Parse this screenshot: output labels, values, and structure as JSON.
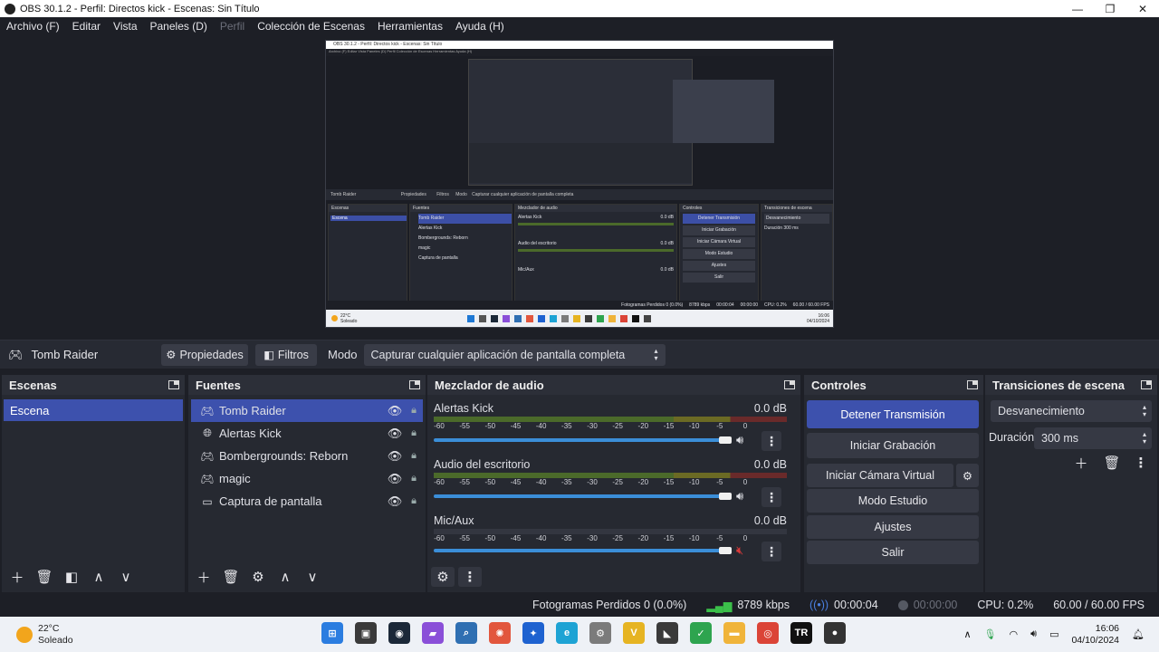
{
  "window": {
    "title": "OBS 30.1.2 - Perfil: Directos kick - Escenas: Sin Título"
  },
  "menu": [
    {
      "label": "Archivo (F)",
      "disabled": false
    },
    {
      "label": "Editar",
      "disabled": false
    },
    {
      "label": "Vista",
      "disabled": false
    },
    {
      "label": "Paneles (D)",
      "disabled": false
    },
    {
      "label": "Perfil",
      "disabled": true
    },
    {
      "label": "Colección de Escenas",
      "disabled": false
    },
    {
      "label": "Herramientas",
      "disabled": false
    },
    {
      "label": "Ayuda (H)",
      "disabled": false
    }
  ],
  "toolbar": {
    "source_name": "Tomb Raider",
    "properties_label": "Propiedades",
    "filters_label": "Filtros",
    "mode_label": "Modo",
    "mode_value": "Capturar cualquier aplicación de pantalla completa"
  },
  "scenes": {
    "title": "Escenas",
    "items": [
      "Escena"
    ]
  },
  "sources": {
    "title": "Fuentes",
    "items": [
      {
        "name": "Tomb Raider",
        "icon": "gamepad-icon"
      },
      {
        "name": "Alertas Kick",
        "icon": "globe-icon"
      },
      {
        "name": "Bombergrounds: Reborn",
        "icon": "gamepad-icon"
      },
      {
        "name": "magic",
        "icon": "gamepad-icon"
      },
      {
        "name": "Captura de pantalla",
        "icon": "monitor-icon"
      }
    ]
  },
  "mixer": {
    "title": "Mezclador de audio",
    "ticks": [
      "-60",
      "-55",
      "-50",
      "-45",
      "-40",
      "-35",
      "-30",
      "-25",
      "-20",
      "-15",
      "-10",
      "-5",
      "0"
    ],
    "channels": [
      {
        "name": "Alertas Kick",
        "db": "0.0 dB",
        "muted": false
      },
      {
        "name": "Audio del escritorio",
        "db": "0.0 dB",
        "muted": false
      },
      {
        "name": "Mic/Aux",
        "db": "0.0 dB",
        "muted": true
      }
    ]
  },
  "controls": {
    "title": "Controles",
    "stop_stream": "Detener Transmisión",
    "start_record": "Iniciar Grabación",
    "start_virtualcam": "Iniciar Cámara Virtual",
    "studio_mode": "Modo Estudio",
    "settings": "Ajustes",
    "exit": "Salir"
  },
  "transitions": {
    "title": "Transiciones de escena",
    "selected": "Desvanecimiento",
    "duration_label": "Duración",
    "duration_value": "300 ms"
  },
  "status": {
    "dropped": "Fotogramas Perdidos 0 (0.0%)",
    "bitrate": "8789 kbps",
    "stream_time": "00:00:04",
    "rec_time": "00:00:00",
    "cpu": "CPU: 0.2%",
    "fps": "60.00 / 60.00 FPS"
  },
  "taskbar": {
    "temp": "22°C",
    "weather": "Soleado",
    "time": "16:06",
    "date": "04/10/2024"
  },
  "preview_inner": {
    "title": "OBS 30.1.2 - Perfil: Directos kick - Escenas: Sin Título",
    "menu": "Archivo (F)   Editar   Vista   Paneles (D)   Perfil   Colección de Escenas   Herramientas   Ayuda (H)",
    "source": "Tomb Raider",
    "props": "Propiedades",
    "filters": "Filtros",
    "mode": "Modo",
    "mode_value": "Capturar cualquier aplicación de pantalla completa",
    "scenes": "Escenas",
    "scene": "Escena",
    "sources": "Fuentes",
    "src1": "Tomb Raider",
    "src2": "Alertas Kick",
    "src3": "Bombergrounds: Reborn",
    "src4": "magic",
    "src5": "Captura de pantalla",
    "mixer": "Mezclador de audio",
    "ch1": "Alertas Kick",
    "ch2": "Audio del escritorio",
    "ch3": "Mic/Aux",
    "db": "0.0 dB",
    "controls": "Controles",
    "c1": "Detener Transmisión",
    "c2": "Iniciar Grabación",
    "c3": "Iniciar Cámara Virtual",
    "c4": "Modo Estudio",
    "c5": "Ajustes",
    "c6": "Salir",
    "transitions": "Transiciones de escena",
    "tsel": "Desvanecimiento",
    "tdur": "Duración",
    "tval": "300 ms",
    "status": "Fotogramas Perdidos 0 (0.0%)     8789 kbps     00:00:04     00:00:00     CPU: 0.2%     60.00 / 60.00 FPS",
    "temp": "22°C",
    "weather": "Soleado",
    "time": "16:06",
    "date": "04/10/2024"
  },
  "colors": {
    "accent": "#3d51ad",
    "fader": "#3b8ed8",
    "panel": "#262931",
    "bg": "#1d1f26"
  }
}
